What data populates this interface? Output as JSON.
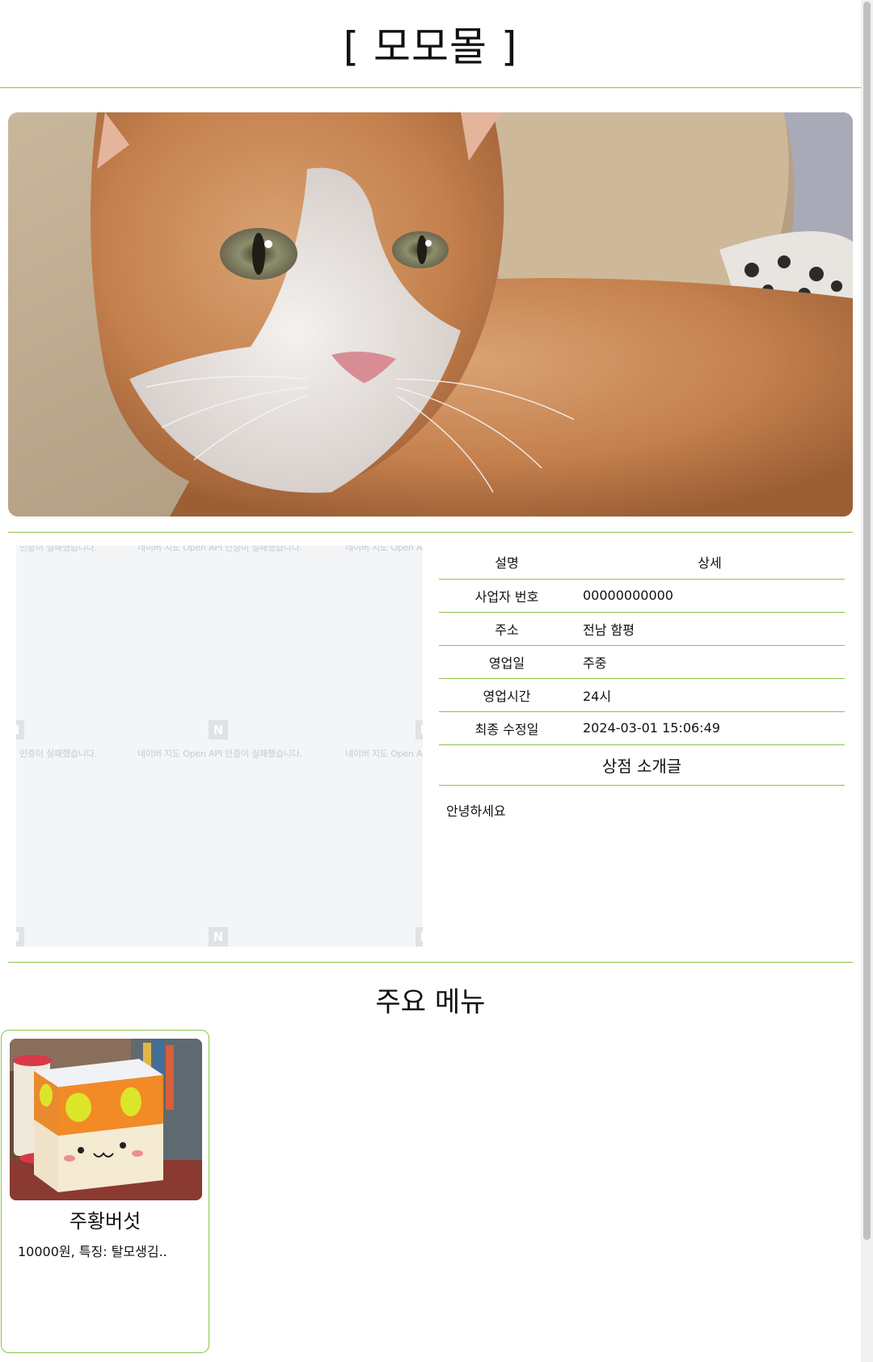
{
  "header": {
    "title": "[ 모모몰 ]"
  },
  "hero": {
    "image": "orange-and-white-cat-photo"
  },
  "map": {
    "watermark_text": "네이버 지도 Open API 인증이 실패했습니다.",
    "watermark_text_partial_left": "인증이 실패했습니다.",
    "watermark_text_partial_right": "네이버 지도 Open A",
    "logo_letter": "N"
  },
  "info": {
    "header_col1": "설명",
    "header_col2": "상세",
    "rows": [
      {
        "label": "사업자 번호",
        "value": "00000000000"
      },
      {
        "label": "주소",
        "value": "전남 함평"
      },
      {
        "label": "영업일",
        "value": "주중"
      },
      {
        "label": "영업시간",
        "value": "24시"
      },
      {
        "label": "최종 수정일",
        "value": "2024-03-01 15:06:49"
      }
    ],
    "intro_title": "상점 소개글",
    "intro_body": "안녕하세요"
  },
  "menu": {
    "title": "주요 메뉴",
    "items": [
      {
        "name": "주황버섯",
        "desc": "10000원, 특징: 탈모생김..",
        "image": "orange-mushroom-box-photo"
      }
    ]
  },
  "colors": {
    "accent": "#8bc34a"
  }
}
